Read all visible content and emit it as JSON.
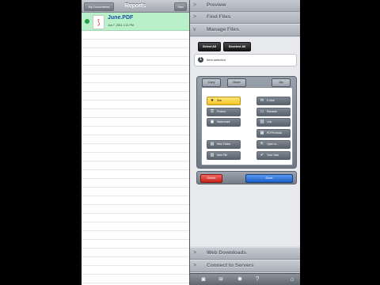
{
  "left": {
    "nav": {
      "back_label": "My Documents",
      "title": "Reports",
      "sort_label": "Sort"
    },
    "file": {
      "name": "June.PDF",
      "date": "Jun 7, 2011 1:21 PM",
      "icon": "pdf-file-icon"
    }
  },
  "right": {
    "sections_top": [
      {
        "label": "Preview",
        "chevron": ">"
      },
      {
        "label": "Find Files",
        "chevron": ">"
      },
      {
        "label": "Manage Files",
        "chevron": "v"
      }
    ],
    "select_all": "Select All",
    "deselect_all": "Deselect All",
    "status": "Item selected",
    "tabs": [
      "Copy",
      "Move",
      "Zip"
    ],
    "actions_left": [
      {
        "label": "Star",
        "icon": "star-icon",
        "glyph": "★"
      },
      {
        "label": "Protect",
        "icon": "lock-icon",
        "glyph": "⚿"
      },
      {
        "label": "Watermark",
        "icon": "watermark-icon",
        "glyph": "▣"
      },
      {
        "label": "New Folder",
        "icon": "folder-icon",
        "glyph": "▤"
      },
      {
        "label": "New File",
        "icon": "file-icon",
        "glyph": "▥"
      }
    ],
    "actions_right": [
      {
        "label": "E-Mail",
        "icon": "mail-icon",
        "glyph": "✉"
      },
      {
        "label": "Rename",
        "icon": "rename-icon",
        "glyph": "▭"
      },
      {
        "label": "Link",
        "icon": "link-icon",
        "glyph": "⛓"
      },
      {
        "label": "PDFPortfolio",
        "icon": "portfolio-icon",
        "glyph": "▦"
      },
      {
        "label": "Open In...",
        "icon": "open-in-icon",
        "glyph": "⇱"
      },
      {
        "label": "Todo Task",
        "icon": "check-icon",
        "glyph": "✔"
      }
    ],
    "delete_label": "Delete",
    "done_label": "Done",
    "sections_bottom": [
      {
        "label": "Web Downloads",
        "chevron": ">"
      },
      {
        "label": "Connect to Servers",
        "chevron": ">"
      }
    ],
    "toolbar": [
      {
        "name": "camera-icon",
        "glyph": "◙"
      },
      {
        "name": "wifi-icon",
        "glyph": "≋"
      },
      {
        "name": "settings-gear-icon",
        "glyph": "✹"
      },
      {
        "name": "help-icon",
        "glyph": "?"
      },
      {
        "name": "lock-icon",
        "glyph": "⌂"
      }
    ]
  },
  "colors": {
    "selected_row": "#b8f0c9",
    "delete": "#d93a33",
    "done": "#2b6fd8",
    "star": "#f3c423"
  }
}
